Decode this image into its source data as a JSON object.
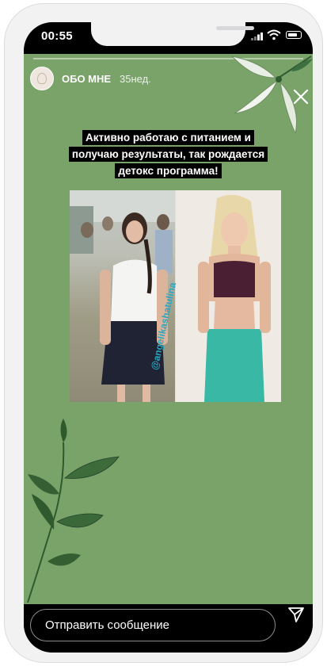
{
  "status_bar": {
    "time": "00:55"
  },
  "story": {
    "progress": 0.0,
    "profile_name": "ОБО МНЕ",
    "time_ago": "35нед.",
    "caption_lines": [
      "Активно работаю с питанием и",
      "получаю результаты, так рождается",
      "детокс программа!"
    ],
    "watermark": "@angelikashatulina",
    "background_color": "#7aa36a"
  },
  "reply": {
    "placeholder": "Отправить сообщение"
  },
  "icons": {
    "close": "close-icon",
    "send": "send-icon",
    "signal": "signal-icon",
    "wifi": "wifi-icon",
    "battery": "battery-icon"
  }
}
